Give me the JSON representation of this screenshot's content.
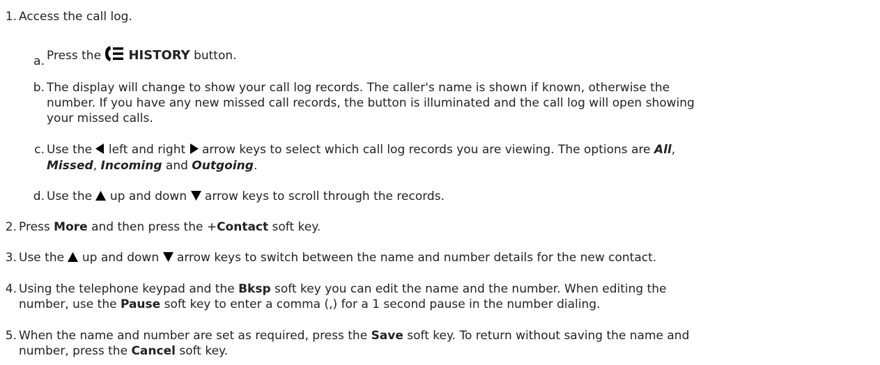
{
  "steps": [
    {
      "num": "1.",
      "text": "Access the call log.",
      "substeps": [
        {
          "num": "a.",
          "before": "Press the ",
          "button": "HISTORY",
          "after": " button."
        },
        {
          "num": "b.",
          "text": "The display will change to show your call log records. The caller's name is shown if known, otherwise the\nnumber. If you have any new missed call records, the button is illuminated and the call log will open showing\nyour missed calls."
        },
        {
          "num": "c.",
          "p1": "Use the ",
          "p2": " left and right ",
          "p3": " arrow keys to select which call log records you are viewing. The options are ",
          "all": "All",
          "comma1": ",",
          "missed": "Missed",
          "comma2": ", ",
          "incoming": "Incoming",
          "and": " and ",
          "outgoing": "Outgoing",
          "end": "."
        },
        {
          "num": "d.",
          "p1": "Use the ",
          "p2": " up and down ",
          "p3": " arrow keys to scroll through the records."
        }
      ]
    },
    {
      "num": "2.",
      "p1": "Press ",
      "more": "More",
      "p2": " and then press the +",
      "contact": "Contact",
      "p3": " soft key."
    },
    {
      "num": "3.",
      "p1": "Use the ",
      "p2": " up and down ",
      "p3": " arrow keys to switch between the name and number details for the new contact."
    },
    {
      "num": "4.",
      "p1": "Using the telephone keypad and the ",
      "bksp": "Bksp",
      "p2": " soft key you can edit the name and the number. When editing the\nnumber, use the ",
      "pause": "Pause",
      "p3": " soft key to enter a comma (,) for a 1 second pause in the number dialing."
    },
    {
      "num": "5.",
      "p1": "When the name and number are set as required, press the ",
      "save": "Save",
      "p2": " soft key. To return without saving the name and\nnumber, press the ",
      "cancel": "Cancel",
      "p3": " soft key."
    }
  ],
  "icons": {
    "history": "call-history-icon",
    "left": "left-arrow-icon",
    "right": "right-arrow-icon",
    "up": "up-arrow-icon",
    "down": "down-arrow-icon"
  }
}
